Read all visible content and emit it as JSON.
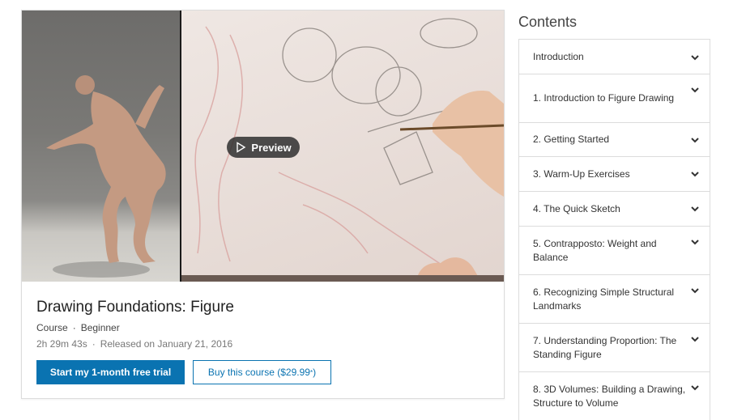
{
  "course": {
    "title": "Drawing Foundations: Figure",
    "type": "Course",
    "level": "Beginner",
    "duration": "2h 29m 43s",
    "released": "Released on January 21, 2016",
    "preview_label": "Preview",
    "primary_button": "Start my 1-month free trial",
    "secondary_button": "Buy this course ($29.99",
    "secondary_button_sup": "*",
    "secondary_button_close": ")"
  },
  "contents": {
    "title": "Contents",
    "items": [
      {
        "label": "Introduction"
      },
      {
        "label": "1. Introduction to Figure Drawing"
      },
      {
        "label": "2. Getting Started"
      },
      {
        "label": "3. Warm-Up Exercises"
      },
      {
        "label": "4. The Quick Sketch"
      },
      {
        "label": "5. Contrapposto: Weight and Balance"
      },
      {
        "label": "6. Recognizing Simple Structural Landmarks"
      },
      {
        "label": "7. Understanding Proportion: The Standing Figure"
      },
      {
        "label": "8. 3D Volumes: Building a Drawing, Structure to Volume"
      }
    ]
  },
  "colors": {
    "accent": "#0a73b1",
    "border": "#dcdcdc"
  }
}
